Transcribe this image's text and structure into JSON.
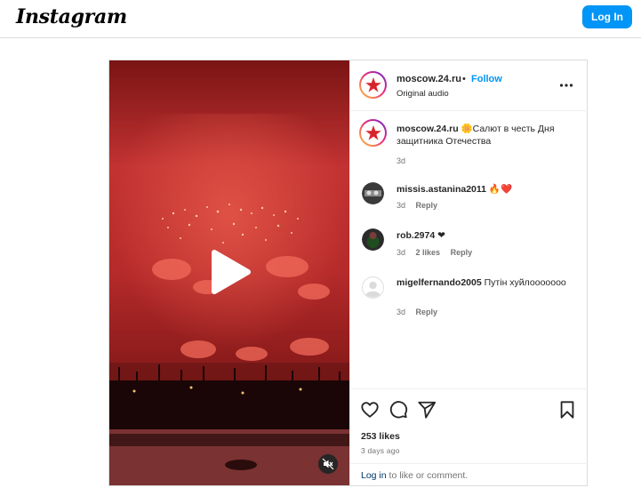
{
  "topbar": {
    "logo": "Instagram",
    "login_button": "Log In"
  },
  "post": {
    "account": {
      "username": "moscow.24.ru",
      "separator": "•",
      "follow_label": "Follow",
      "audio": "Original audio"
    },
    "caption": {
      "username": "moscow.24.ru",
      "text": "🌼Салют в честь Дня защитника Отечества",
      "time": "3d"
    },
    "comments": [
      {
        "username": "missis.astanina2011",
        "text": "🔥❤️",
        "time": "3d",
        "likes": "",
        "reply": "Reply"
      },
      {
        "username": "rob.2974",
        "text": "❤",
        "time": "3d",
        "likes": "2 likes",
        "reply": "Reply"
      },
      {
        "username": "migelfernando2005",
        "text": "Путін хуйлооооооо",
        "time": "3d",
        "likes": "",
        "reply": "Reply"
      }
    ],
    "likes": "253 likes",
    "posted": "3 days ago",
    "login_prompt": {
      "link": "Log in",
      "rest": " to like or comment."
    }
  },
  "colors": {
    "accent": "#0095f6",
    "border": "#dbdbdb",
    "muted": "#737373",
    "video_red": "#c02b2b"
  },
  "icons": [
    "more-options-icon",
    "play-icon",
    "mute-icon",
    "like-heart-icon",
    "comment-icon",
    "share-icon",
    "save-bookmark-icon"
  ]
}
